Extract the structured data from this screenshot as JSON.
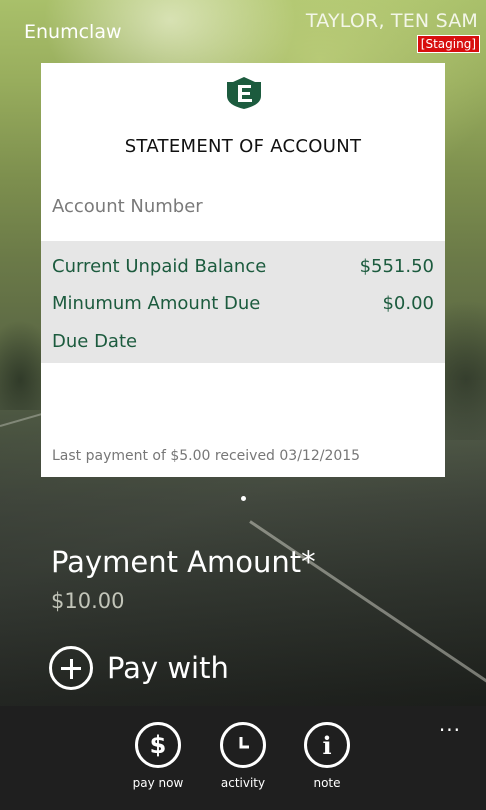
{
  "header": {
    "app_title": "Enumclaw",
    "user_name": "TAYLOR, TEN SAM",
    "environment_badge": "[Staging]"
  },
  "statement": {
    "logo_icon": "enumclaw-shield-icon",
    "title": "STATEMENT OF ACCOUNT",
    "account_number_label": "Account Number",
    "rows": [
      {
        "label": "Current Unpaid Balance",
        "value": "$551.50"
      },
      {
        "label": "Minumum Amount Due",
        "value": "$0.00"
      },
      {
        "label": "Due Date",
        "value": ""
      }
    ],
    "last_payment": "Last payment of $5.00 received 03/12/2015"
  },
  "payment": {
    "amount_label": "Payment Amount*",
    "amount_value": "$10.00",
    "pay_with_label": "Pay with",
    "pay_with_icon": "plus-circle-icon"
  },
  "appbar": {
    "more_label": "...",
    "buttons": [
      {
        "label": "pay now",
        "icon": "dollar-icon",
        "glyph": "$"
      },
      {
        "label": "activity",
        "icon": "clock-icon",
        "glyph": ""
      },
      {
        "label": "note",
        "icon": "info-icon",
        "glyph": "i"
      }
    ]
  },
  "colors": {
    "brand_green": "#1c5b3e",
    "staging_red": "#d80e0e",
    "appbar_bg": "#1f1f1f"
  }
}
